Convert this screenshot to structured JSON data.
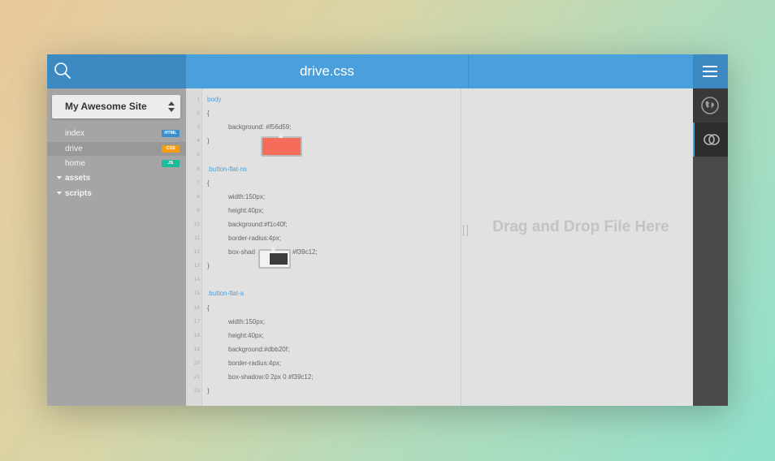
{
  "header": {
    "title": "drive.css",
    "search_icon": "search-icon",
    "menu_icon": "hamburger-menu-icon"
  },
  "sidebar": {
    "site_selector": "My Awesome Site",
    "files": [
      {
        "name": "index",
        "badge": "HTML",
        "badge_color": "#3a8fd0"
      },
      {
        "name": "drive",
        "badge": "CSS",
        "badge_color": "#f39c12",
        "active": true
      },
      {
        "name": "home",
        "badge": "JS",
        "badge_color": "#1abc9c"
      }
    ],
    "folders": [
      "assets",
      "scripts"
    ]
  },
  "editor": {
    "line_numbers": [
      "1",
      "2",
      "3",
      "4",
      "5",
      "6",
      "7",
      "8",
      "9",
      "10",
      "11",
      "12",
      "13",
      "14",
      "15",
      "16",
      "17",
      "18",
      "19",
      "20",
      "21",
      "22"
    ],
    "lines": [
      {
        "text": "body",
        "selector": true
      },
      {
        "text": "{"
      },
      {
        "text": "background: #f56d59;",
        "indent": true
      },
      {
        "text": "}"
      },
      {
        "text": ""
      },
      {
        "text": ".button-flat-ns",
        "selector": true
      },
      {
        "text": "{"
      },
      {
        "text": "width:150px;",
        "indent": true
      },
      {
        "text": "height:40px;",
        "indent": true
      },
      {
        "text": "background:#f1c40f;",
        "indent": true
      },
      {
        "text": "border-radius:4px;",
        "indent": true
      },
      {
        "text": "box-shad",
        "indent": true,
        "tail": "#f39c12;"
      },
      {
        "text": "}"
      },
      {
        "text": ""
      },
      {
        "text": ".button-flat-a",
        "selector": true
      },
      {
        "text": "{"
      },
      {
        "text": "width:150px;",
        "indent": true
      },
      {
        "text": "height:40px;",
        "indent": true
      },
      {
        "text": "background:#dbb20f;",
        "indent": true
      },
      {
        "text": "border-radius:4px;",
        "indent": true
      },
      {
        "text": "box-shadow:0 2px 0 #f39c12;",
        "indent": true
      },
      {
        "text": "}"
      }
    ],
    "swatch_colors": [
      "#f56d59",
      "#3c3c3c"
    ]
  },
  "dropzone": {
    "text": "Drag and Drop File Here"
  },
  "rail": {
    "icons": [
      "globe-icon",
      "linked-circles-icon"
    ]
  },
  "colors": {
    "accent": "#4aa0dc",
    "header_dark": "#3d8ac3"
  }
}
